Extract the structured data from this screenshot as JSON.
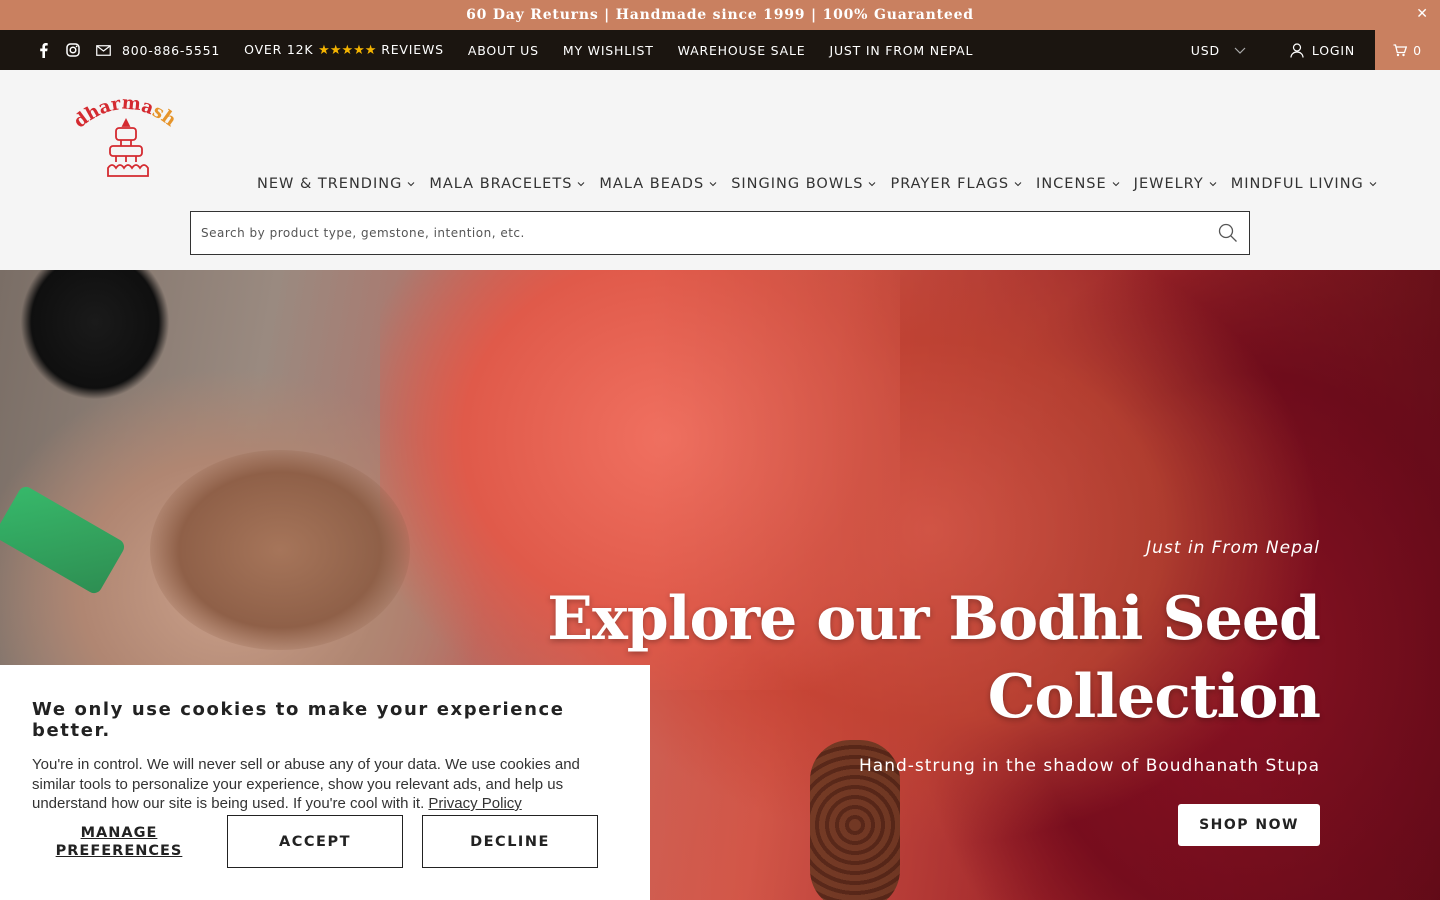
{
  "announcement": {
    "text": "60 Day Returns | Handmade since 1999 | 100% Guaranteed",
    "close_icon": "close-icon"
  },
  "topbar": {
    "phone": "800-886-5551",
    "reviews_prefix": "OVER 12K",
    "reviews_stars": "★★★★★",
    "reviews_suffix": "REVIEWS",
    "links": [
      "ABOUT US",
      "MY WISHLIST",
      "WAREHOUSE SALE",
      "JUST IN FROM NEPAL"
    ],
    "currency": "USD",
    "login": "LOGIN",
    "cart_count": "0",
    "icons": [
      "facebook-icon",
      "instagram-icon",
      "mail-icon",
      "user-icon",
      "cart-icon",
      "chevron-down-icon"
    ]
  },
  "header": {
    "logo_alt": "dharmashop",
    "nav": [
      "NEW & TRENDING",
      "MALA BRACELETS",
      "MALA BEADS",
      "SINGING BOWLS",
      "PRAYER FLAGS",
      "INCENSE",
      "JEWELRY",
      "MINDFUL LIVING"
    ],
    "search_placeholder": "Search by product type, gemstone, intention, etc."
  },
  "hero": {
    "kicker": "Just in From Nepal",
    "title_line1": "Explore our Bodhi Seed",
    "title_line2": "Collection",
    "subtitle": "Hand-strung in the shadow of Boudhanath Stupa",
    "cta": "SHOP NOW"
  },
  "cookie": {
    "title": "We only use cookies to make your experience better.",
    "body": "You're in control. We will never sell or abuse any of your data. We use cookies and similar tools to personalize your experience, show you relevant ads, and help us understand how our site is being used. If you're cool with it.",
    "privacy_link": "Privacy Policy",
    "manage_line1": "MANAGE",
    "manage_line2": "PREFERENCES",
    "accept": "ACCEPT",
    "decline": "DECLINE"
  },
  "colors": {
    "accent": "#c98060",
    "topbar_bg": "#1b1510",
    "star": "#f5b400",
    "logo_red": "#d42a30",
    "logo_orange": "#e6952c"
  }
}
